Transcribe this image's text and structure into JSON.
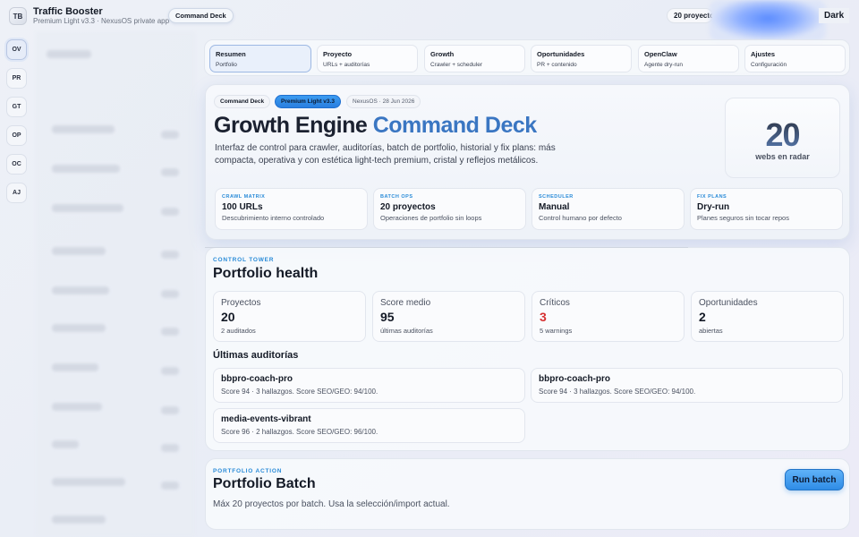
{
  "app": {
    "logo": "TB",
    "name": "Traffic Booster",
    "subtitle": "Premium Light v3.3 · NexusOS private app",
    "cmd_pill": "Command Deck",
    "projects_pill": "20 proyectos",
    "theme_label": "Dark"
  },
  "rail": [
    "OV",
    "PR",
    "GT",
    "OP",
    "OC",
    "AJ"
  ],
  "tabs": [
    {
      "label": "Resumen",
      "sub": "Portfolio"
    },
    {
      "label": "Proyecto",
      "sub": "URLs + auditorías"
    },
    {
      "label": "Growth",
      "sub": "Crawler + scheduler"
    },
    {
      "label": "Oportunidades",
      "sub": "PR + contenido"
    },
    {
      "label": "OpenClaw",
      "sub": "Agente dry-run"
    },
    {
      "label": "Ajustes",
      "sub": "Configuración"
    }
  ],
  "hero": {
    "chip1": "Command Deck",
    "chip2": "Premium Light v3.3",
    "chip3": "NexusOS · 28 Jun 2026",
    "title_a": "Growth Engine ",
    "title_b": "Command Deck",
    "desc": "Interfaz de control para crawler, auditorías, batch de portfolio, historial y fix plans: más compacta, operativa y con estética light-tech premium, cristal y reflejos metálicos.",
    "radar_num": "20",
    "radar_label": "webs en radar",
    "cards": [
      {
        "k": "CRAWL MATRIX",
        "v": "100 URLs",
        "s": "Descubrimiento interno controlado"
      },
      {
        "k": "BATCH OPS",
        "v": "20 proyectos",
        "s": "Operaciones de portfolio sin loops"
      },
      {
        "k": "SCHEDULER",
        "v": "Manual",
        "s": "Control humano por defecto"
      },
      {
        "k": "FIX PLANS",
        "v": "Dry-run",
        "s": "Planes seguros sin tocar repos"
      }
    ]
  },
  "health": {
    "eyebrow": "CONTROL TOWER",
    "title": "Portfolio health",
    "stats": [
      {
        "k": "Proyectos",
        "v": "20",
        "s": "2 auditados"
      },
      {
        "k": "Score medio",
        "v": "95",
        "s": "últimas auditorías"
      },
      {
        "k": "Críticos",
        "v": "3",
        "s": "5 warnings"
      },
      {
        "k": "Oportunidades",
        "v": "2",
        "s": "abiertas"
      }
    ],
    "audits_title": "Últimas auditorías",
    "audits": [
      {
        "name": "bbpro-coach-pro",
        "desc": "Score 94 · 3 hallazgos. Score SEO/GEO: 94/100."
      },
      {
        "name": "bbpro-coach-pro",
        "desc": "Score 94 · 3 hallazgos. Score SEO/GEO: 94/100."
      },
      {
        "name": "media-events-vibrant",
        "desc": "Score 96 · 2 hallazgos. Score SEO/GEO: 96/100."
      }
    ]
  },
  "batch": {
    "eyebrow": "PORTFOLIO ACTION",
    "title": "Portfolio Batch",
    "desc": "Máx 20 proyectos por batch. Usa la selección/import actual.",
    "button": "Run batch"
  }
}
